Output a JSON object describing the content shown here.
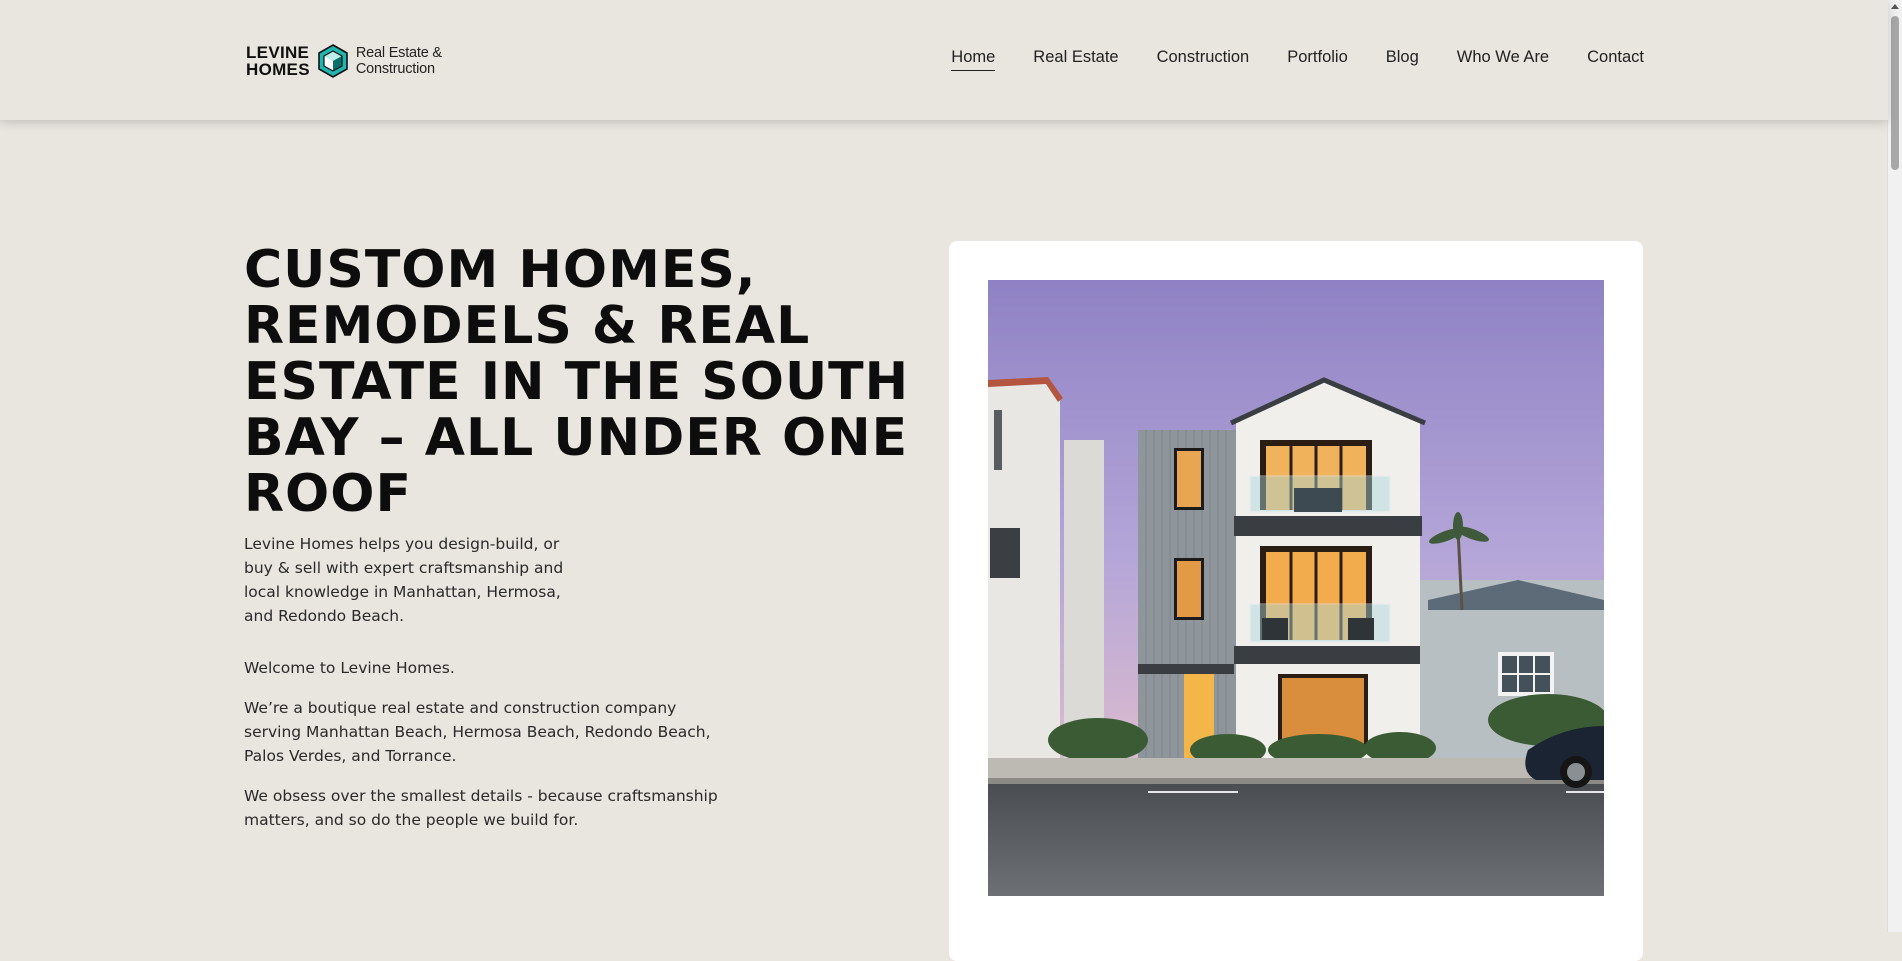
{
  "logo": {
    "line1": "LEVINE",
    "line2": "HOMES",
    "tag_line1": "Real Estate &",
    "tag_line2": "Construction",
    "icon": "hexagon-cube-icon",
    "accent": "#1fb6b0"
  },
  "nav": [
    {
      "label": "Home",
      "active": true
    },
    {
      "label": "Real Estate"
    },
    {
      "label": "Construction"
    },
    {
      "label": "Portfolio"
    },
    {
      "label": "Blog"
    },
    {
      "label": "Who We Are"
    },
    {
      "label": "Contact"
    }
  ],
  "hero": {
    "title": "CUSTOM HOMES, REMODELS & REAL ESTATE IN THE SOUTH BAY – ALL UNDER ONE ROOF",
    "intro": "Levine Homes helps you design-build, or buy & sell with expert craftsmanship and local knowledge in Manhattan, Hermosa, and Redondo Beach.",
    "welcome": "Welcome to Levine Homes.",
    "about": "We’re a boutique real estate and construction company serving Manhattan Beach, Hermosa Beach, Redondo Beach, Palos Verdes, and Torrance.",
    "obsess": "We obsess over the smallest details - because craftsmanship matters, and so do the people we build for."
  },
  "colors": {
    "background": "#e9e5df",
    "text": "#0d0d0d",
    "card": "#ffffff"
  }
}
